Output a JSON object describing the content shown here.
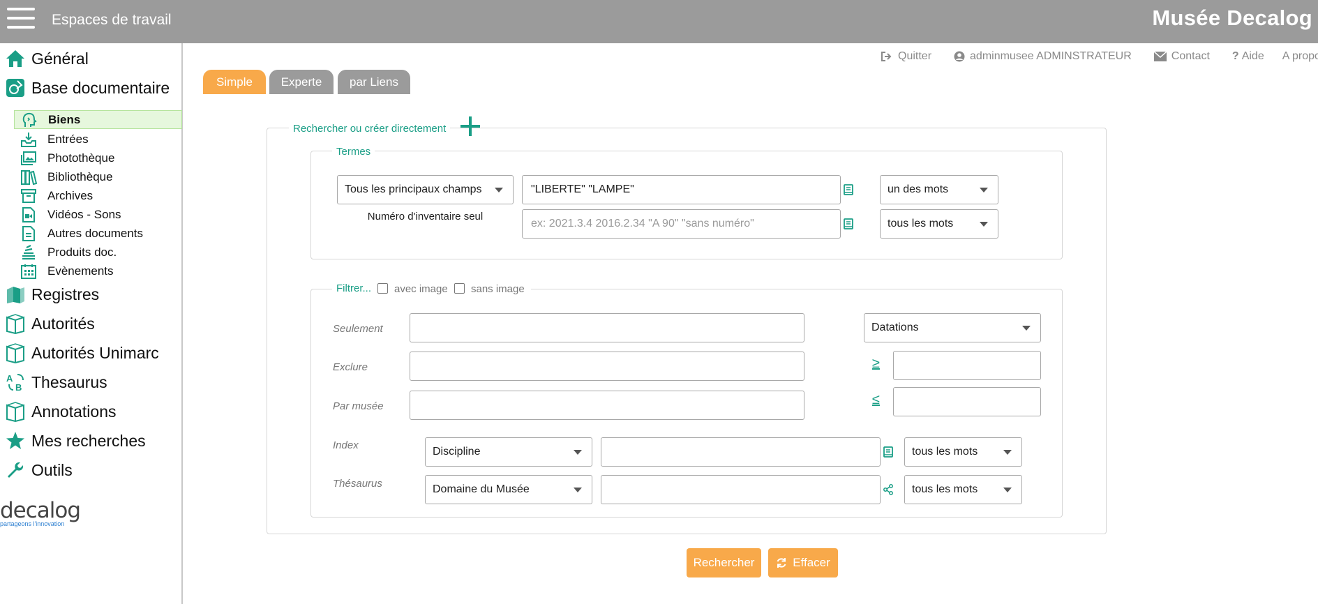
{
  "header": {
    "workspaces_label": "Espaces de travail",
    "app_title": "Musée Decalog"
  },
  "sidebar": {
    "main_top": [
      {
        "label": "Général",
        "icon": "home-icon"
      },
      {
        "label": "Base documentaire",
        "icon": "docbase-icon"
      }
    ],
    "sub_items": [
      {
        "label": "Biens",
        "icon": "head-icon",
        "active": true
      },
      {
        "label": "Entrées",
        "icon": "inbox-icon"
      },
      {
        "label": "Photothèque",
        "icon": "images-icon"
      },
      {
        "label": "Bibliothèque",
        "icon": "books-icon"
      },
      {
        "label": "Archives",
        "icon": "archive-icon"
      },
      {
        "label": "Vidéos - Sons",
        "icon": "video-file-icon"
      },
      {
        "label": "Autres documents",
        "icon": "file-icon"
      },
      {
        "label": "Produits doc.",
        "icon": "stack-icon"
      },
      {
        "label": "Evènements",
        "icon": "calendar-icon"
      }
    ],
    "main_bottom": [
      {
        "label": "Registres",
        "icon": "registers-icon"
      },
      {
        "label": "Autorités",
        "icon": "open-book-icon"
      },
      {
        "label": "Autorités Unimarc",
        "icon": "open-book-icon"
      },
      {
        "label": "Thesaurus",
        "icon": "thesaurus-icon"
      },
      {
        "label": "Annotations",
        "icon": "open-book-icon"
      },
      {
        "label": "Mes recherches",
        "icon": "star-icon"
      },
      {
        "label": "Outils",
        "icon": "wrench-icon"
      }
    ],
    "logo_word": "decalog",
    "logo_tagline": "partageons l'innovation"
  },
  "toplinks": {
    "quit": "Quitter",
    "user": "adminmusee ADMINSTRATEUR",
    "contact": "Contact",
    "help": "Aide",
    "about": "A propo"
  },
  "tabs": {
    "simple": "Simple",
    "experte": "Experte",
    "liens": "par Liens"
  },
  "search": {
    "legend": "Rechercher  ou créer directement",
    "terms": {
      "legend": "Termes",
      "field_select": "Tous les principaux champs",
      "terms_value": "\"LIBERTE\" \"LAMPE\"",
      "mode1": "un des mots",
      "inventory_label": "Numéro d'inventaire seul",
      "inventory_placeholder": "ex: 2021.3.4 2016.2.34 \"A 90\" \"sans numéro\"",
      "mode2": "tous les mots"
    },
    "filter": {
      "legend": "Filtrer...",
      "with_image": "avec image",
      "without_image": "sans image",
      "only_label": "Seulement",
      "exclude_label": "Exclure",
      "museum_label": "Par  musée",
      "dating_select": "Datations",
      "gte": "≥",
      "lte": "≤",
      "index_label": "Index",
      "index_select": "Discipline",
      "index_mode": "tous les mots",
      "thesaurus_label": "Thésaurus",
      "thesaurus_select": "Domaine du Musée",
      "thesaurus_mode": "tous les mots"
    }
  },
  "buttons": {
    "search": "Rechercher",
    "clear": "Effacer"
  },
  "colors": {
    "accent_teal": "#1a9e86",
    "orange": "#f8a94a",
    "topbar_gray": "#9b9b9b"
  }
}
